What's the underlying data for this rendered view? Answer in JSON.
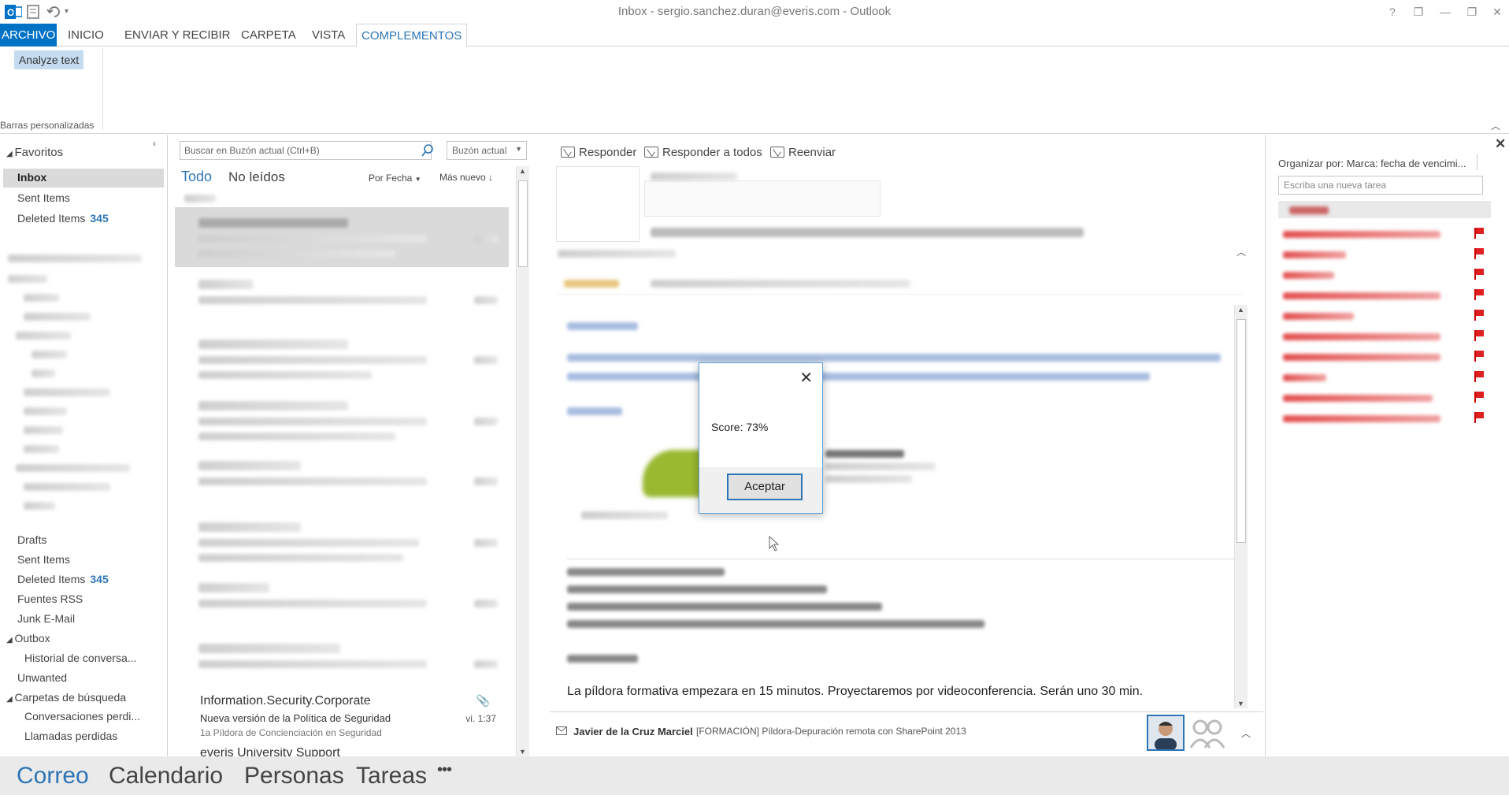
{
  "window": {
    "title": "Inbox - sergio.sanchez.duran@everis.com - Outlook",
    "controls": [
      "?",
      "❐",
      "—",
      "❐",
      "✕"
    ]
  },
  "ribbon": {
    "tabs": [
      "ARCHIVO",
      "INICIO",
      "ENVIAR Y RECIBIR",
      "CARPETA",
      "VISTA",
      "COMPLEMENTOS"
    ],
    "active_tab": "COMPLEMENTOS",
    "button": "Analyze text",
    "group_label": "Barras personalizadas"
  },
  "folders": {
    "favorites_header": "Favoritos",
    "favorites": [
      {
        "label": "Inbox",
        "count": ""
      },
      {
        "label": "Sent Items",
        "count": ""
      },
      {
        "label": "Deleted Items",
        "count": "345"
      }
    ],
    "lower": [
      {
        "label": "Drafts",
        "count": "",
        "indent": 0
      },
      {
        "label": "Sent Items",
        "count": "",
        "indent": 0
      },
      {
        "label": "Deleted Items",
        "count": "345",
        "indent": 0
      },
      {
        "label": "Fuentes RSS",
        "count": "",
        "indent": 0
      },
      {
        "label": "Junk E-Mail",
        "count": "",
        "indent": 0
      },
      {
        "label": "Outbox",
        "count": "",
        "indent": 0
      },
      {
        "label": "Historial de conversa...",
        "count": "",
        "indent": 1
      },
      {
        "label": "Unwanted",
        "count": "",
        "indent": 0
      },
      {
        "label": "Carpetas de búsqueda",
        "count": "",
        "indent": 0
      },
      {
        "label": "Conversaciones perdi...",
        "count": "",
        "indent": 1
      },
      {
        "label": "Llamadas perdidas",
        "count": "",
        "indent": 1
      }
    ]
  },
  "list": {
    "search_placeholder": "Buscar en Buzón actual (Ctrl+B)",
    "scope": "Buzón actual",
    "filter_all": "Todo",
    "filter_unread": "No leídos",
    "sort_by": "Por Fecha",
    "order": "Más nuevo",
    "visible_message": {
      "sender": "Information.Security.Corporate",
      "subject": "Nueva versión de la Política de Seguridad",
      "preview": "1a Píldora de Concienciación en Seguridad",
      "date": "vi. 1:37"
    },
    "next_sender": "everis University Support"
  },
  "reading": {
    "actions": [
      "Responder",
      "Responder a todos",
      "Reenviar"
    ],
    "body_text": "La píldora formativa empezara en 15 minutos. Proyectaremos por videoconferencia. Serán uno 30 min.",
    "people_sender": "Javier de la Cruz Marciel",
    "people_subject": "[FORMACIÓN] Píldora-Depuración remota con SharePoint 2013"
  },
  "tasks": {
    "arrange_label": "Organizar por: Marca: fecha de vencimi...",
    "new_task_placeholder": "Escriba una nueva tarea"
  },
  "dialog": {
    "message": "Score: 73%",
    "ok_label": "Aceptar"
  },
  "navbar": [
    "Correo",
    "Calendario",
    "Personas",
    "Tareas",
    "•••"
  ]
}
